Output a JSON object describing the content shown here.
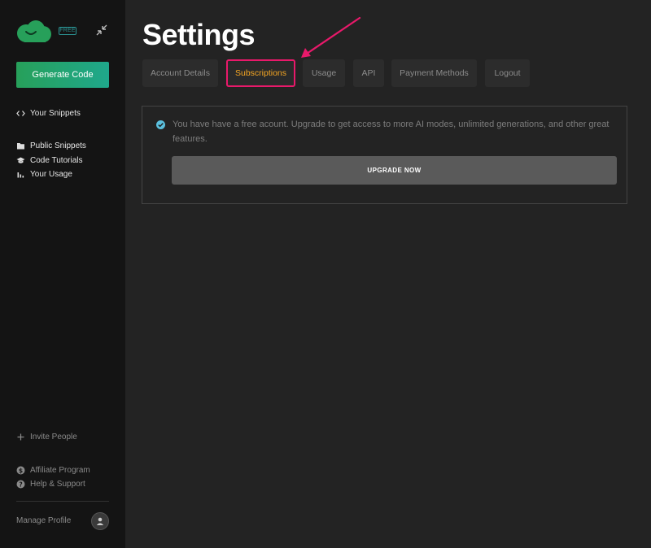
{
  "sidebar": {
    "badge": "FREE",
    "generate_label": "Generate Code",
    "nav": {
      "your_snippets": "Your Snippets",
      "public_snippets": "Public Snippets",
      "code_tutorials": "Code Tutorials",
      "your_usage": "Your Usage"
    },
    "footer": {
      "invite": "Invite People",
      "affiliate": "Affiliate Program",
      "help": "Help & Support",
      "manage_profile": "Manage Profile"
    }
  },
  "main": {
    "title": "Settings",
    "tabs": [
      {
        "label": "Account Details"
      },
      {
        "label": "Subscriptions"
      },
      {
        "label": "Usage"
      },
      {
        "label": "API"
      },
      {
        "label": "Payment Methods"
      },
      {
        "label": "Logout"
      }
    ],
    "active_tab": "Subscriptions",
    "notice": {
      "text": "You have have a free acount. Upgrade to get access to more AI modes, unlimited generations, and other great features.",
      "button": "UPGRADE NOW"
    }
  },
  "colors": {
    "accent_green": "#27a05a",
    "active_tab_text": "#f5a623",
    "highlight": "#e8196a",
    "check": "#5bc0de"
  },
  "icons": {
    "logo": "cloud-smile-logo",
    "collapse": "collapse-arrows-icon",
    "your_snippets": "code-brackets-icon",
    "public_snippets": "folder-icon",
    "code_tutorials": "graduation-cap-icon",
    "your_usage": "bar-chart-icon",
    "invite": "plus-icon",
    "affiliate": "dollar-icon",
    "help": "question-icon",
    "avatar": "user-icon",
    "notice": "check-circle-icon"
  }
}
